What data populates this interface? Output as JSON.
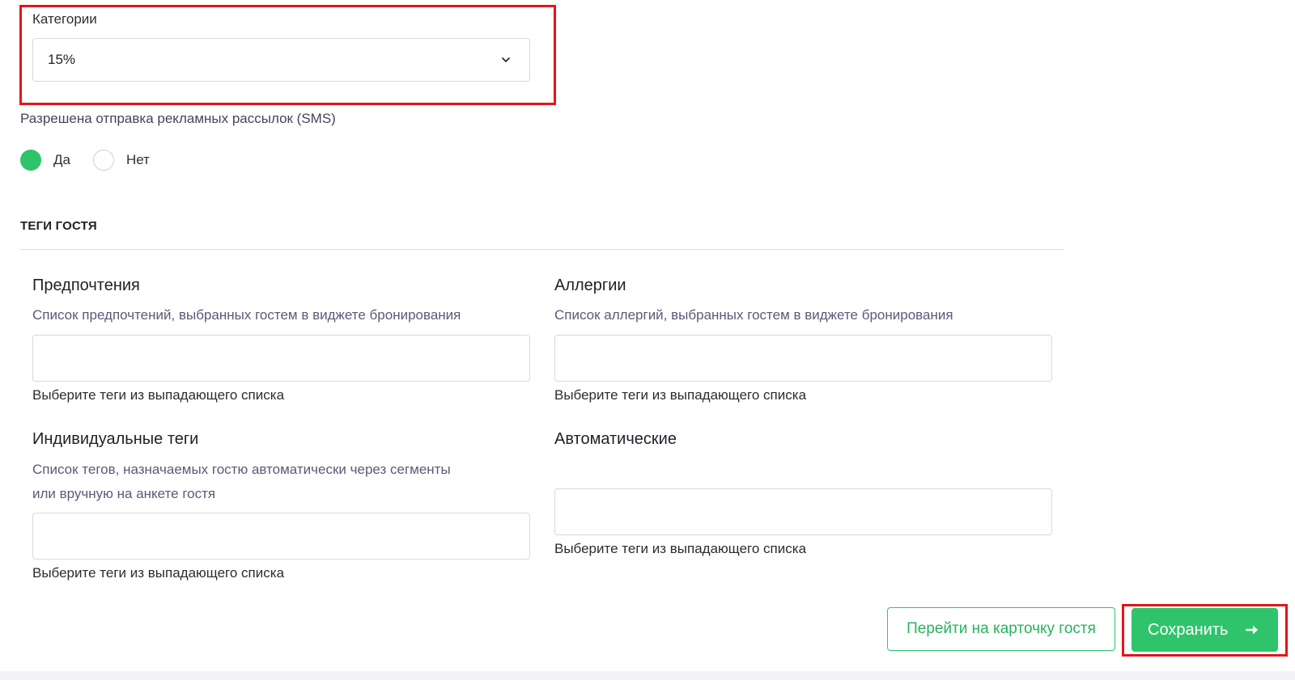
{
  "category": {
    "label": "Категории",
    "selected_value": "15%"
  },
  "sms": {
    "label": "Разрешена отправка рекламных рассылок (SMS)",
    "options": [
      {
        "label": "Да",
        "checked": true
      },
      {
        "label": "Нет",
        "checked": false
      }
    ]
  },
  "tags": {
    "section_title": "ТЕГИ ГОСТЯ",
    "preferences": {
      "title": "Предпочтения",
      "description": "Список предпочтений, выбранных гостем в виджете бронирования",
      "hint": "Выберите теги из выпадающего списка"
    },
    "allergies": {
      "title": "Аллергии",
      "description": "Список аллергий, выбранных гостем в виджете бронирования",
      "hint": "Выберите теги из выпадающего списка"
    },
    "individual": {
      "title": "Индивидуальные теги",
      "description_line1": "Список тегов, назначаемых гостю автоматически через сегменты",
      "description_line2": "или вручную на анкете гостя",
      "hint": "Выберите теги из выпадающего списка"
    },
    "automatic": {
      "title": "Автоматические",
      "hint": "Выберите теги из выпадающего списка"
    }
  },
  "actions": {
    "go_to_card_label": "Перейти на карточку гостя",
    "save_label": "Сохранить"
  },
  "colors": {
    "accent": "#2fc46b",
    "highlight": "#e3141b"
  },
  "icons": {
    "select": "chevron-down-icon",
    "save": "arrow-right-icon"
  }
}
